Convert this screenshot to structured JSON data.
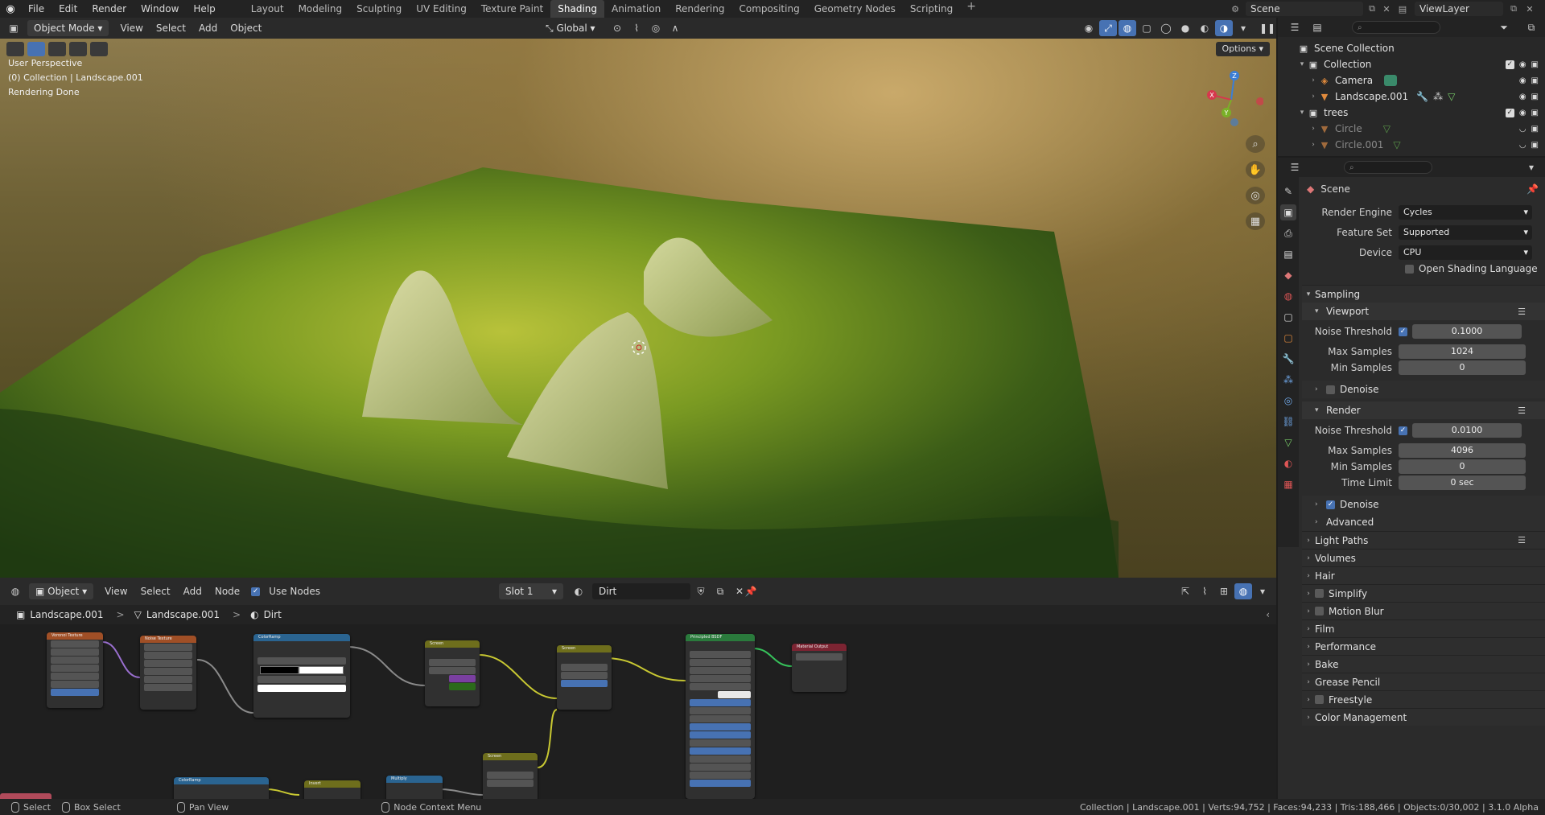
{
  "topbar": {
    "menus": [
      "File",
      "Edit",
      "Render",
      "Window",
      "Help"
    ],
    "workspaces": [
      "Layout",
      "Modeling",
      "Sculpting",
      "UV Editing",
      "Texture Paint",
      "Shading",
      "Animation",
      "Rendering",
      "Compositing",
      "Geometry Nodes",
      "Scripting"
    ],
    "active_workspace": "Shading",
    "scene": "Scene",
    "view_layer": "ViewLayer"
  },
  "viewport_header": {
    "mode": "Object Mode",
    "menus": [
      "View",
      "Select",
      "Add",
      "Object"
    ],
    "orientation": "Global",
    "options_label": "Options"
  },
  "viewport": {
    "info": [
      "User Perspective",
      "(0) Collection | Landscape.001",
      "Rendering Done"
    ],
    "axes": {
      "x": "X",
      "y": "Y",
      "z": "Z"
    }
  },
  "node_editor": {
    "type": "Object",
    "menus": [
      "View",
      "Select",
      "Add",
      "Node"
    ],
    "use_nodes_label": "Use Nodes",
    "slot": "Slot 1",
    "material": "Dirt",
    "breadcrumb": [
      "Landscape.001",
      "Landscape.001",
      "Dirt"
    ],
    "nodes": [
      {
        "title": "Voronoi Texture"
      },
      {
        "title": "Noise Texture"
      },
      {
        "title": "ColorRamp"
      },
      {
        "title": "Screen"
      },
      {
        "title": "Screen"
      },
      {
        "title": "Principled BSDF"
      },
      {
        "title": "Material Output"
      },
      {
        "title": "ColorRamp"
      },
      {
        "title": "Invert"
      },
      {
        "title": "Multiply"
      },
      {
        "title": "Screen"
      }
    ]
  },
  "statusbar": {
    "select": "Select",
    "box_select": "Box Select",
    "pan_view": "Pan View",
    "context_menu": "Node Context Menu",
    "stats": "Collection | Landscape.001 | Verts:94,752 | Faces:94,233 | Tris:188,466 | Objects:0/30,002 | 3.1.0 Alpha"
  },
  "outliner": {
    "root": "Scene Collection",
    "items": [
      {
        "label": "Collection",
        "level": 1
      },
      {
        "label": "Camera",
        "level": 2
      },
      {
        "label": "Landscape.001",
        "level": 2
      },
      {
        "label": "trees",
        "level": 1
      },
      {
        "label": "Circle",
        "level": 2
      },
      {
        "label": "Circle.001",
        "level": 2
      }
    ]
  },
  "properties": {
    "title": "Scene",
    "render_engine_label": "Render Engine",
    "render_engine": "Cycles",
    "feature_set_label": "Feature Set",
    "feature_set": "Supported",
    "device_label": "Device",
    "device": "CPU",
    "osl_label": "Open Shading Language",
    "sampling": "Sampling",
    "viewport": "Viewport",
    "noise_threshold_label": "Noise Threshold",
    "vp_noise_threshold": "0.1000",
    "max_samples_label": "Max Samples",
    "vp_max_samples": "1024",
    "min_samples_label": "Min Samples",
    "vp_min_samples": "0",
    "denoise": "Denoise",
    "render": "Render",
    "r_noise_threshold": "0.0100",
    "r_max_samples": "4096",
    "r_min_samples": "0",
    "time_limit_label": "Time Limit",
    "time_limit": "0 sec",
    "advanced": "Advanced",
    "panels": [
      "Light Paths",
      "Volumes",
      "Hair",
      "Simplify",
      "Motion Blur",
      "Film",
      "Performance",
      "Bake",
      "Grease Pencil",
      "Freestyle",
      "Color Management"
    ]
  }
}
